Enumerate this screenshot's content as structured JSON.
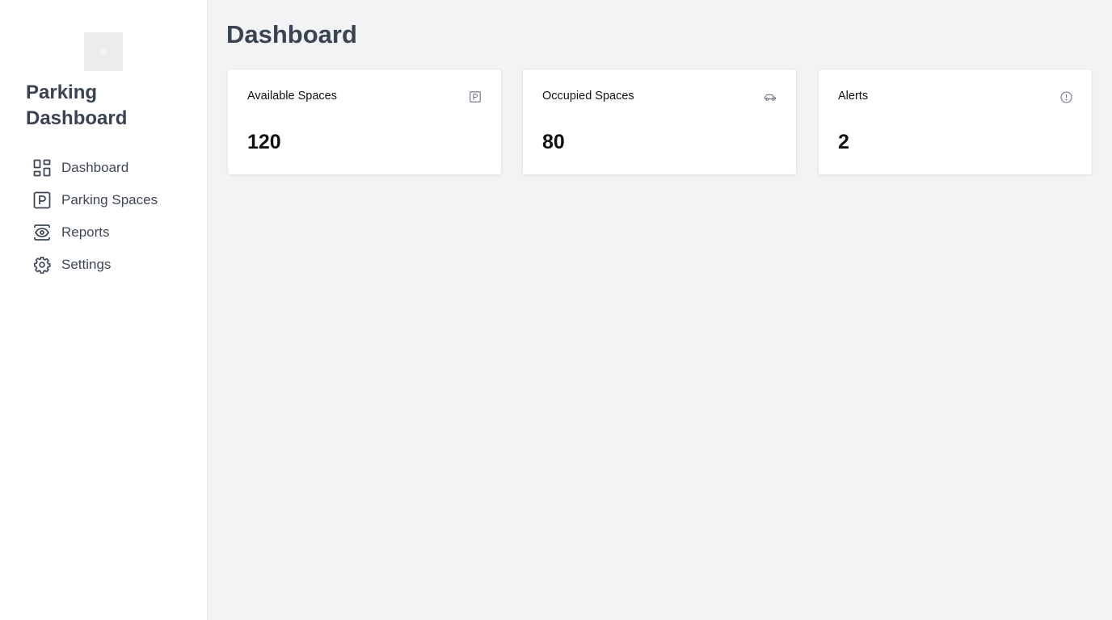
{
  "sidebar": {
    "brand_line1": "Parking",
    "brand_line2": "Dashboard",
    "items": [
      {
        "label": "Dashboard",
        "icon": "dashboard-grid-icon"
      },
      {
        "label": "Parking Spaces",
        "icon": "parking-p-icon"
      },
      {
        "label": "Reports",
        "icon": "eye-icon"
      },
      {
        "label": "Settings",
        "icon": "gear-icon"
      }
    ]
  },
  "main": {
    "title": "Dashboard",
    "cards": [
      {
        "label": "Available Spaces",
        "value": "120",
        "icon": "parking-p-icon"
      },
      {
        "label": "Occupied Spaces",
        "value": "80",
        "icon": "car-icon"
      },
      {
        "label": "Alerts",
        "value": "2",
        "icon": "alert-circle-icon"
      }
    ]
  },
  "colors": {
    "background": "#f2f3f5",
    "sidebar": "#ffffff",
    "text_heading": "#3a4352",
    "text_value": "#111111"
  }
}
